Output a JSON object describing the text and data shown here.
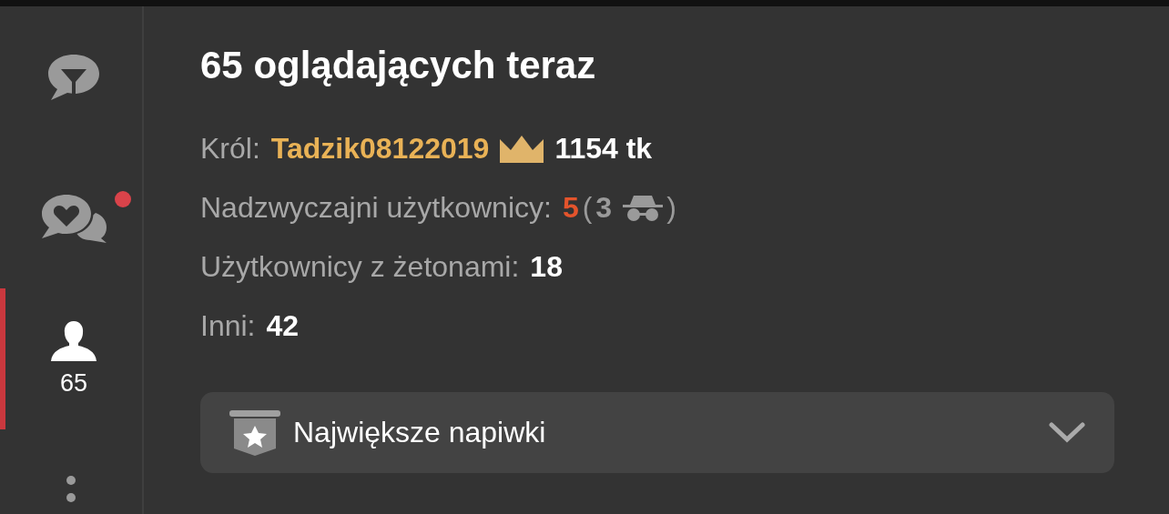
{
  "sidebar": {
    "items": [
      {
        "kind": "lobby",
        "selected": false,
        "notification": false
      },
      {
        "kind": "private",
        "selected": false,
        "notification": true
      },
      {
        "kind": "users",
        "selected": true,
        "notification": false,
        "count": "65"
      }
    ]
  },
  "title": "65 oglądających teraz",
  "king": {
    "label": "Król:",
    "name": "Tadzik08122019",
    "amount": "1154 tk"
  },
  "stats": [
    {
      "kind": "special",
      "label": "Nadzwyczajni użytkownicy:",
      "value": "5",
      "open": "(",
      "hidden": "3",
      "close": ")"
    },
    {
      "kind": "plain",
      "label": "Użytkownicy z żetonami:",
      "value": "18"
    },
    {
      "kind": "plain",
      "label": "Inni:",
      "value": "42"
    }
  ],
  "dropdown": {
    "label": "Największe napiwki",
    "expanded": false
  }
}
